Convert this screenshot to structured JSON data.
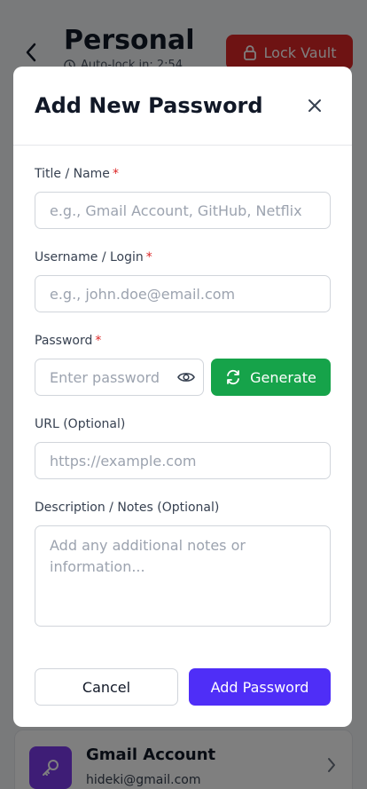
{
  "background": {
    "vault_title": "Personal",
    "autolock_text": "Auto-lock in: 2:54",
    "lock_button_label": "Lock Vault",
    "entry": {
      "title": "Gmail Account",
      "subtitle": "hideki@gmail.com",
      "icon": "key-icon"
    }
  },
  "modal": {
    "title": "Add New Password",
    "fields": {
      "title": {
        "label": "Title / Name",
        "required_mark": "*",
        "placeholder": "e.g., Gmail Account, GitHub, Netflix",
        "value": ""
      },
      "username": {
        "label": "Username / Login",
        "required_mark": "*",
        "placeholder": "e.g., john.doe@email.com",
        "value": ""
      },
      "password": {
        "label": "Password",
        "required_mark": "*",
        "placeholder": "Enter password",
        "value": ""
      },
      "url": {
        "label": "URL (Optional)",
        "placeholder": "https://example.com",
        "value": ""
      },
      "notes": {
        "label": "Description / Notes (Optional)",
        "placeholder": "Add any additional notes or information...",
        "value": ""
      }
    },
    "generate_label": "Generate",
    "cancel_label": "Cancel",
    "submit_label": "Add Password"
  },
  "colors": {
    "primary": "#4f2ef7",
    "generate": "#16a34a",
    "lock": "#dc2626",
    "entry_icon_bg": "#7c3aed"
  }
}
